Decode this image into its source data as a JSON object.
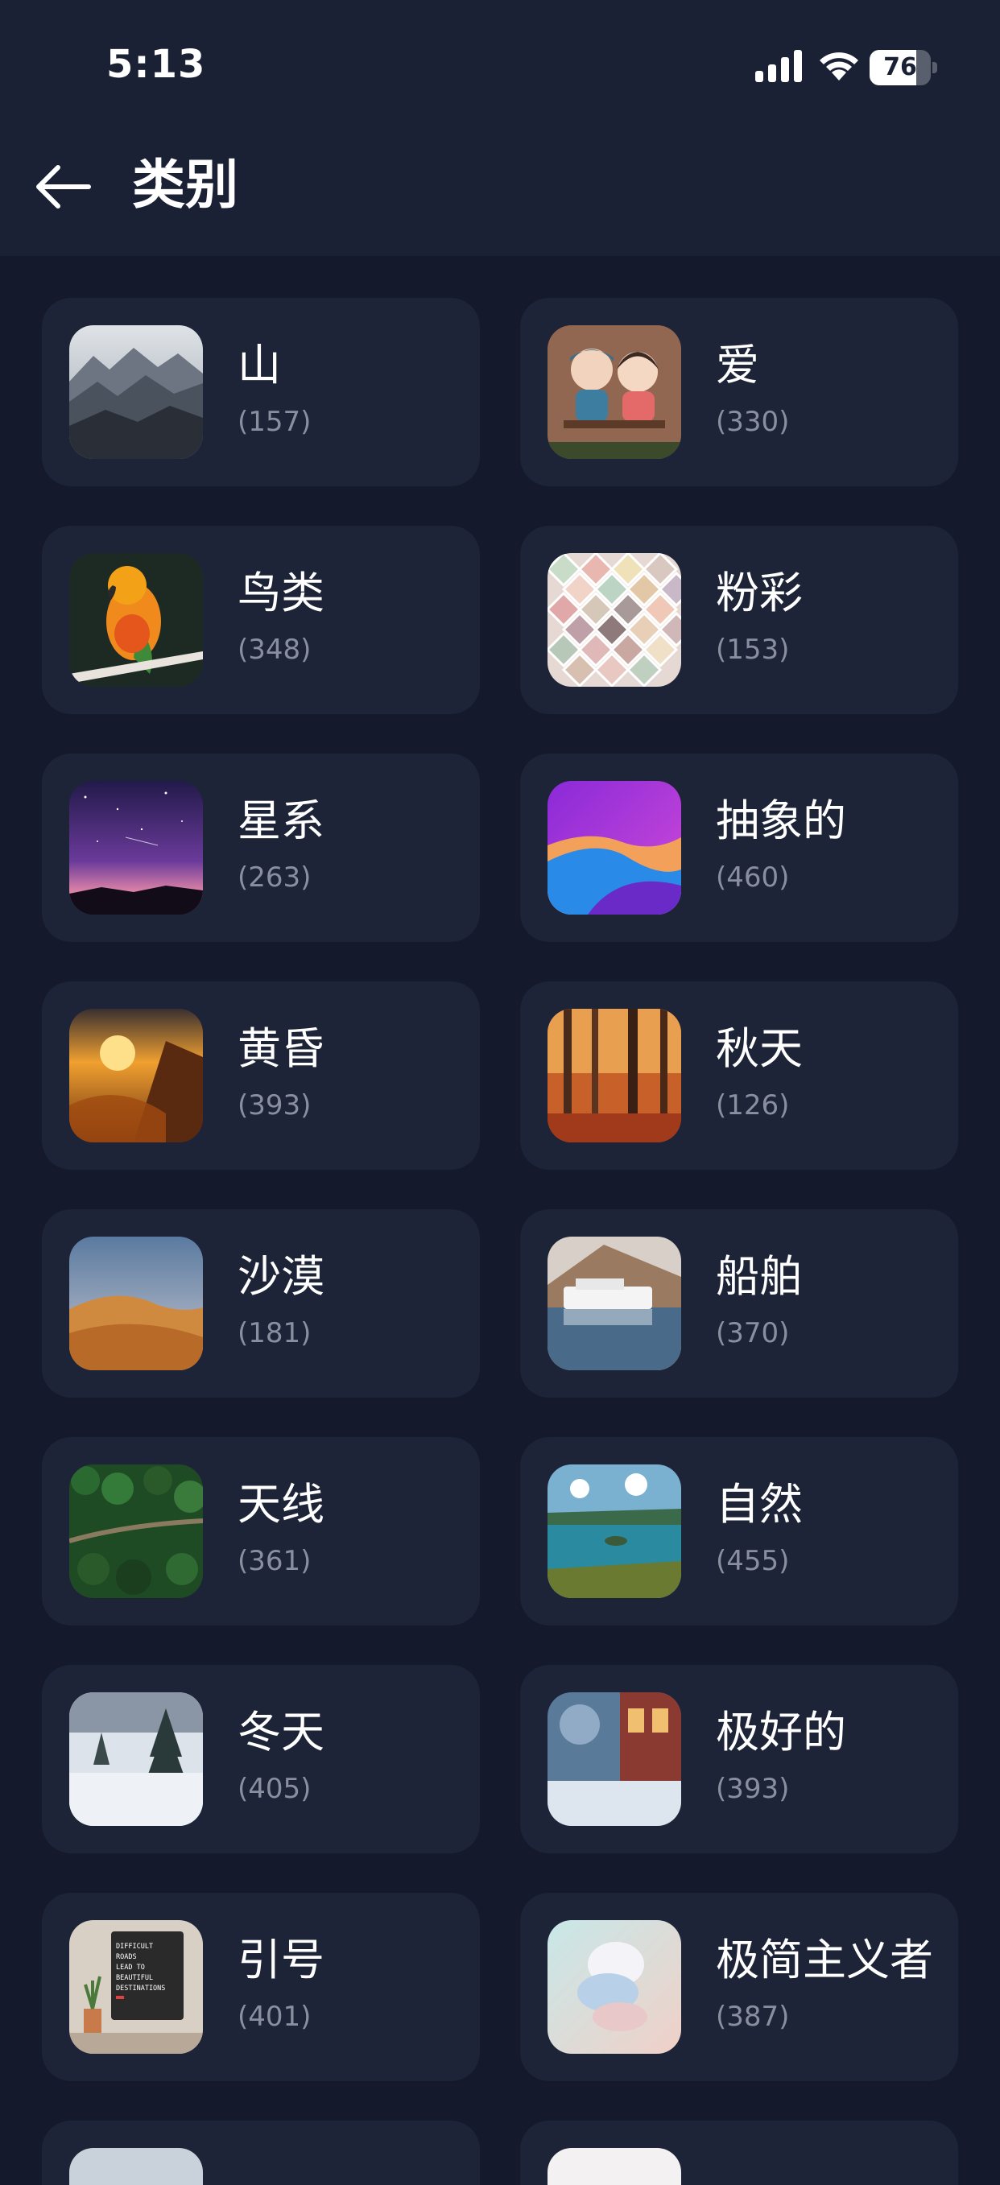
{
  "status_bar": {
    "time": "5:13",
    "battery": "76",
    "battery_level": 0.76
  },
  "header": {
    "title": "类别"
  },
  "categories": [
    {
      "name": "山",
      "count": "(157)",
      "thumb": "mountains"
    },
    {
      "name": "爱",
      "count": "(330)",
      "thumb": "toy-couple"
    },
    {
      "name": "鸟类",
      "count": "(348)",
      "thumb": "parrot"
    },
    {
      "name": "粉彩",
      "count": "(153)",
      "thumb": "pastel-scales"
    },
    {
      "name": "星系",
      "count": "(263)",
      "thumb": "night-sky"
    },
    {
      "name": "抽象的",
      "count": "(460)",
      "thumb": "abstract-waves"
    },
    {
      "name": "黄昏",
      "count": "(393)",
      "thumb": "sunset-valley"
    },
    {
      "name": "秋天",
      "count": "(126)",
      "thumb": "autumn-forest"
    },
    {
      "name": "沙漠",
      "count": "(181)",
      "thumb": "desert-dunes"
    },
    {
      "name": "船舶",
      "count": "(370)",
      "thumb": "boat-lake"
    },
    {
      "name": "天线",
      "count": "(361)",
      "thumb": "forest-road"
    },
    {
      "name": "自然",
      "count": "(455)",
      "thumb": "lake-islands"
    },
    {
      "name": "冬天",
      "count": "(405)",
      "thumb": "snowy-trees"
    },
    {
      "name": "极好的",
      "count": "(393)",
      "thumb": "snowy-street"
    },
    {
      "name": "引号",
      "count": "(401)",
      "thumb": "quote-board"
    },
    {
      "name": "极简主义者",
      "count": "(387)",
      "thumb": "stacked-shapes"
    }
  ],
  "quote_board_text": "DIFFICULT ROADS LEAD TO BEAUTIFUL DESTINATIONS",
  "colors": {
    "background": "#141a2c",
    "card": "#1e2438",
    "count_text": "#8a8fa0"
  }
}
